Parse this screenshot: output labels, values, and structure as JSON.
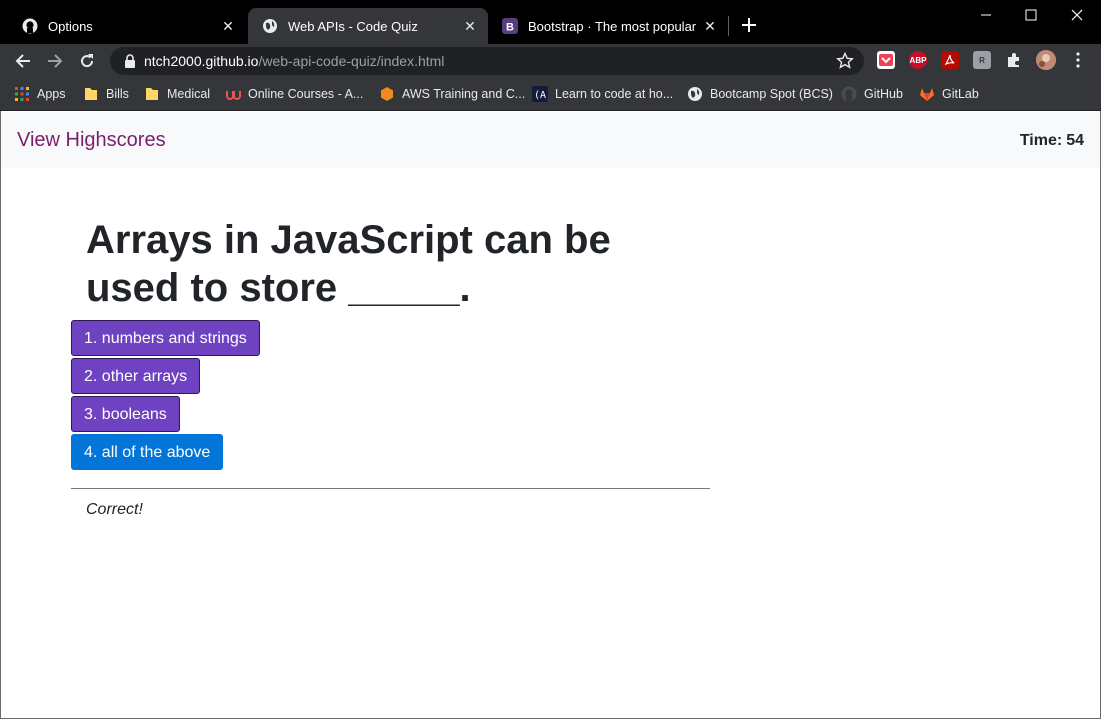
{
  "browser": {
    "tabs": [
      {
        "title": "Options",
        "icon": "github-icon"
      },
      {
        "title": "Web APIs - Code Quiz",
        "icon": "globe-icon"
      },
      {
        "title": "Bootstrap · The most popular HTML",
        "icon": "bootstrap-icon"
      }
    ],
    "url_host": "ntch2000.github.io",
    "url_path": "/web-api-code-quiz/index.html",
    "bookmarks": [
      {
        "label": "Apps",
        "icon": "apps-grid-icon"
      },
      {
        "label": "Bills",
        "icon": "folder-icon"
      },
      {
        "label": "Medical",
        "icon": "folder-icon"
      },
      {
        "label": "Online Courses - A...",
        "icon": "udemy-icon"
      },
      {
        "label": "AWS Training and C...",
        "icon": "aws-icon"
      },
      {
        "label": "Learn to code at ho...",
        "icon": "codecademy-icon"
      },
      {
        "label": "Bootcamp Spot (BCS)",
        "icon": "globe-icon"
      },
      {
        "label": "GitHub",
        "icon": "github-icon"
      },
      {
        "label": "GitLab",
        "icon": "gitlab-icon"
      }
    ],
    "extensions": [
      "pocket-icon",
      "adblock-plus-icon",
      "acrobat-icon",
      "extension-gray-icon",
      "puzzle-icon",
      "profile-avatar"
    ],
    "colors": {
      "tabstrip": "#000000",
      "toolbar": "#35363a",
      "omnibox": "#202124"
    }
  },
  "quiz": {
    "highscores_link": "View Highscores",
    "timer_label": "Time:",
    "timer_value": "54",
    "question": "Arrays in JavaScript can be used to store _____.",
    "answers": [
      "1. numbers and strings",
      "2. other arrays",
      "3. booleans",
      "4. all of the above"
    ],
    "highlighted_answer": 4,
    "feedback": "Correct!",
    "colors": {
      "answer_bg": "#6f42c1",
      "answer_highlight_bg": "#0275d8",
      "link": "#7b1f6b",
      "topbar_bg": "#f8f9fa"
    }
  }
}
